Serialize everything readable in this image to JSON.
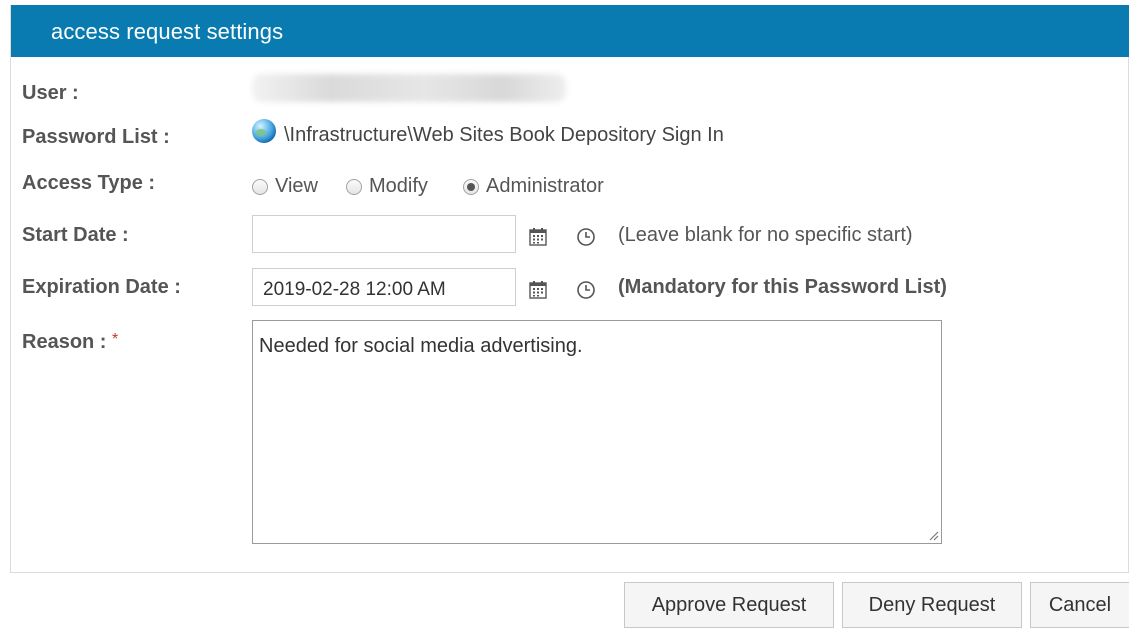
{
  "dialog": {
    "title": "access request settings"
  },
  "fields": {
    "user_label": "User :",
    "password_list_label": "Password List :",
    "password_list_value": "\\Infrastructure\\Web Sites Book Depository Sign In",
    "access_type_label": "Access Type :",
    "access_type_options": [
      {
        "label": "View",
        "selected": false
      },
      {
        "label": "Modify",
        "selected": false
      },
      {
        "label": "Administrator",
        "selected": true
      }
    ],
    "start_date_label": "Start Date :",
    "start_date_value": "",
    "start_date_hint": "(Leave blank for no specific start)",
    "expiration_date_label": "Expiration Date :",
    "expiration_date_value": "2019-02-28 12:00 AM",
    "expiration_date_hint": "(Mandatory for this Password List)",
    "reason_label": "Reason :",
    "reason_required_mark": "*",
    "reason_value": "Needed for social media advertising."
  },
  "buttons": {
    "approve": "Approve Request",
    "deny": "Deny Request",
    "cancel": "Cancel"
  },
  "icons": {
    "password_list": "globe-icon",
    "date_picker": "calendar-icon",
    "time_picker": "clock-icon"
  },
  "colors": {
    "titlebar": "#0a7bb0",
    "required": "#c0392b"
  }
}
